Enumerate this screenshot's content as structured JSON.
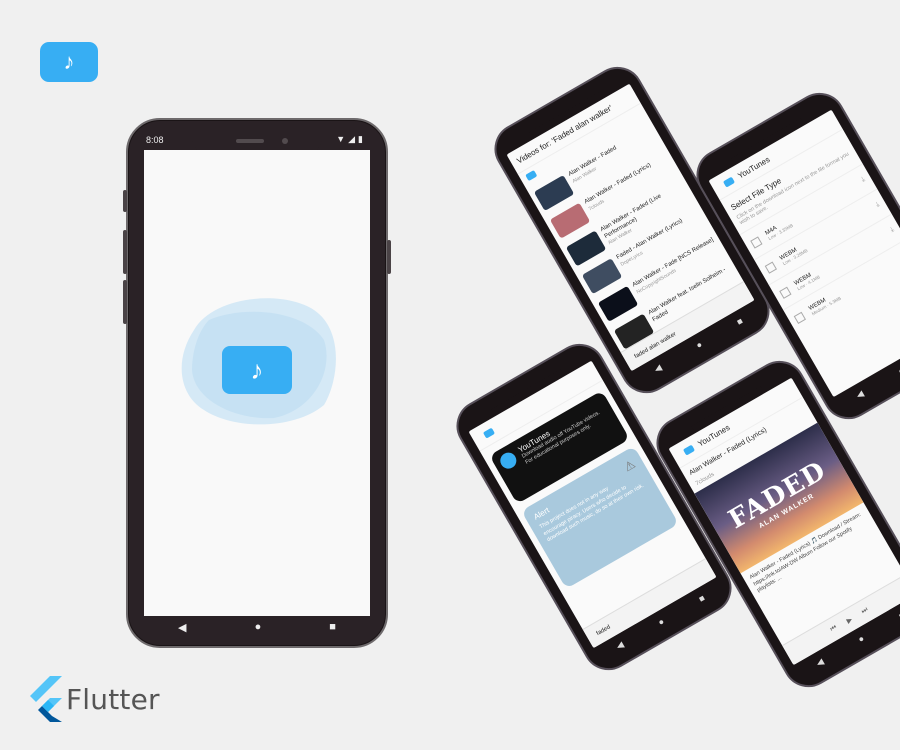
{
  "brand": {
    "app_icon": "music-note-icon",
    "framework_name": "Flutter",
    "accent": "#37aef3"
  },
  "main_phone": {
    "status_time": "8:08",
    "status_icons": "▼◢▮",
    "nav": {
      "back": "◀",
      "home": "●",
      "recents": "■"
    },
    "splash_icon": "music-note-icon"
  },
  "search_screen": {
    "title": "Videos for: 'Faded alan walker'",
    "videos": [
      {
        "title": "Alan Walker - Faded",
        "channel": "Alan Walker",
        "thumb": "#2c3c52"
      },
      {
        "title": "Alan Walker - Faded (Lyrics)",
        "channel": "7clouds",
        "thumb": "#b86c73"
      },
      {
        "title": "Alan Walker - Faded (Live Performance)",
        "channel": "Alan Walker",
        "thumb": "#1d2b3a"
      },
      {
        "title": "Faded - Alan Walker (Lyrics)",
        "channel": "DopeLyrics",
        "thumb": "#3f4d61"
      },
      {
        "title": "Alan Walker - Fade [NCS Release]",
        "channel": "NoCopyrightSounds",
        "thumb": "#0b0f1a"
      },
      {
        "title": "Alan Walker feat. Iselin Solheim - Faded",
        "channel": "",
        "thumb": "#232323"
      }
    ],
    "search_text": "faded alan walker"
  },
  "filetype_screen": {
    "app_title": "YouTunes",
    "title": "Select File Type",
    "subtitle": "Click on the download icon next to the file format you wish to save.",
    "formats": [
      {
        "name": "M4A",
        "meta": "Low · 3.35MB"
      },
      {
        "name": "WEBM",
        "meta": "Low · 3.28MB"
      },
      {
        "name": "WEBM",
        "meta": "Low · 4.1MB"
      },
      {
        "name": "WEBM",
        "meta": "Medium · 5.3MB"
      }
    ]
  },
  "alert_screen": {
    "notif_title": "YouTunes",
    "notif_body": "Download audio off YouTube videos. For educational purposes only.",
    "alert_title": "Alert",
    "alert_body": "This project does not in any way encourage piracy. Users who decide to download such music, do so at their own risk.",
    "search_text": "faded"
  },
  "detail_screen": {
    "app_title": "YouTunes",
    "title": "Alan Walker - Faded (Lyrics)",
    "channel": "7clouds",
    "art_title": "FADED",
    "art_sub": "ALAN WALKER",
    "description": "Alan Walker - Faded (Lyrics) 🎵 Download / Stream: https://lnk.to/AW-DW Album Follow our Spotify playlists: ..."
  }
}
